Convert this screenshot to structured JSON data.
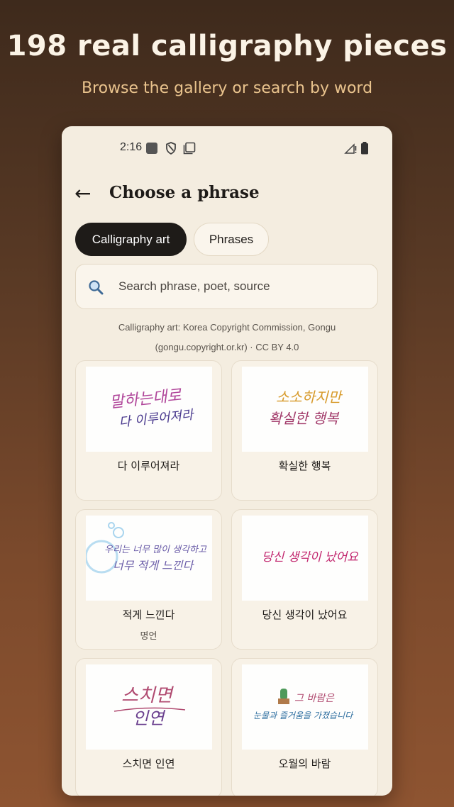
{
  "promo": {
    "title": "198 real calligraphy pieces",
    "subtitle": "Browse the gallery or search by word"
  },
  "status_bar": {
    "time": "2:16",
    "icons": [
      "notification-square-icon",
      "shield-icon",
      "copy-icon",
      "signal-icon",
      "battery-icon"
    ]
  },
  "header": {
    "back_icon": "←",
    "title": "Choose a phrase"
  },
  "tabs": [
    {
      "label": "Calligraphy art",
      "active": true
    },
    {
      "label": "Phrases",
      "active": false
    }
  ],
  "search": {
    "placeholder": "Search phrase, poet, source",
    "value": ""
  },
  "attribution": {
    "line1": "Calligraphy art: Korea Copyright Commission, Gongu",
    "line2": "(gongu.copyright.or.kr) · CC BY 4.0"
  },
  "cards": [
    {
      "label": "다 이루어져라",
      "sub": "",
      "art": {
        "line1": "말하는대로",
        "line2": "다 이루어져라"
      }
    },
    {
      "label": "확실한 행복",
      "sub": "",
      "art": {
        "line1": "소소하지만",
        "line2": "확실한 행복"
      }
    },
    {
      "label": "적게 느낀다",
      "sub": "명언",
      "art": {
        "line1": "우리는 너무 많이 생각하고",
        "line2": "너무 적게 느낀다"
      }
    },
    {
      "label": "당신 생각이 났어요",
      "sub": "",
      "art": {
        "line1": "당신 생각이 났어요",
        "line2": ""
      }
    },
    {
      "label": "스치면 인연",
      "sub": "",
      "art": {
        "line1": "스치면",
        "line2": "인연"
      }
    },
    {
      "label": "오월의 바람",
      "sub": "",
      "art": {
        "line1": "그 바람은",
        "line2": "눈물과 즐거움을 가졌습니다"
      }
    }
  ],
  "colors": {
    "accent_dark": "#1e1b18",
    "background": "#f4ede0",
    "promo_subtitle": "#e9c38d"
  }
}
